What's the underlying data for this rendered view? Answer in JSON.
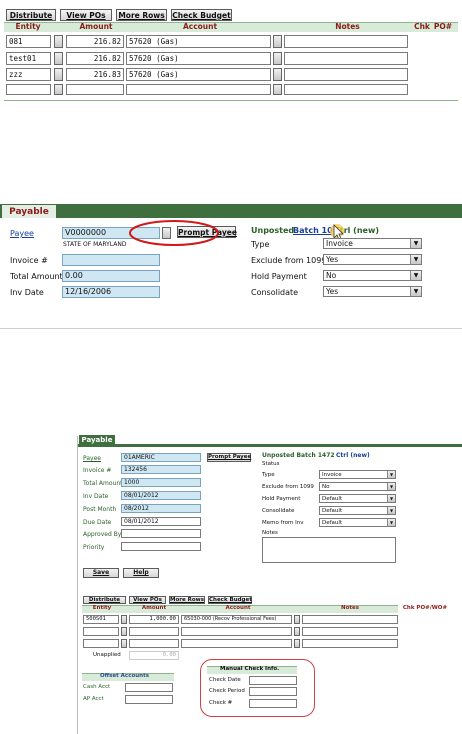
{
  "s1": {
    "buttons": {
      "distribute": "Distribute",
      "view_pos": "View POs",
      "more_rows": "More Rows",
      "check_budget": "Check Budget"
    },
    "headers": {
      "entity": "Entity",
      "amount": "Amount",
      "account": "Account",
      "notes": "Notes",
      "chk": "Chk",
      "po": "PO#"
    },
    "rows": [
      {
        "entity": "081",
        "amount": "216.82",
        "account": "57620 (Gas)"
      },
      {
        "entity": "test01",
        "amount": "216.82",
        "account": "57620 (Gas)"
      },
      {
        "entity": "zzz",
        "amount": "216.83",
        "account": "57620 (Gas)"
      },
      {
        "entity": "",
        "amount": "",
        "account": ""
      }
    ]
  },
  "s2": {
    "tab": "Payable",
    "payee_label": "Payee",
    "payee_value": "V0000000",
    "payee_name": "STATE OF MARYLAND",
    "prompt_payee": "Prompt Payee",
    "invoice_label": "Invoice #",
    "invoice_value": "",
    "total_label": "Total Amount",
    "total_value": "0.00",
    "invdate_label": "Inv Date",
    "invdate_value": "12/16/2006",
    "unposted": "Unposted",
    "batch_prefix": "Batch 10",
    "batch_suffix": "Ctrl (new)",
    "type_label": "Type",
    "type_value": "Invoice",
    "exclude_label": "Exclude from 1099",
    "exclude_value": "Yes",
    "hold_label": "Hold Payment",
    "hold_value": "No",
    "consol_label": "Consolidate",
    "consol_value": "Yes"
  },
  "s3": {
    "tab": "Payable",
    "left": [
      {
        "label": "Payee",
        "value": "01AMERIC",
        "link": true
      },
      {
        "label": "Invoice #",
        "value": "132456"
      },
      {
        "label": "Total Amount",
        "value": "1000"
      },
      {
        "label": "Inv Date",
        "value": "08/01/2012"
      },
      {
        "label": "Post Month",
        "value": "08/2012"
      },
      {
        "label": "Due Date",
        "value": "08/01/2012"
      },
      {
        "label": "Approved By",
        "value": ""
      },
      {
        "label": "Priority",
        "value": ""
      }
    ],
    "prompt_payee": "Prompt Payee",
    "unposted": "Unposted Batch 1472",
    "ctrl": "Ctrl (new)",
    "status_label": "Status",
    "right": [
      {
        "label": "Type",
        "value": "Invoice"
      },
      {
        "label": "Exclude from 1099",
        "value": "No"
      },
      {
        "label": "Hold Payment",
        "value": "Default"
      },
      {
        "label": "Consolidate",
        "value": "Default"
      },
      {
        "label": "Memo from Inv",
        "value": "Default"
      }
    ],
    "notes_label": "Notes",
    "save": "Save",
    "help": "Help",
    "buttons": {
      "distribute": "Distribute",
      "view_pos": "View POs",
      "more_rows": "More Rows",
      "check_budget": "Check Budget"
    },
    "headers": {
      "entity": "Entity",
      "amount": "Amount",
      "account": "Account",
      "notes": "Notes",
      "chk": "Chk PO#/WO#"
    },
    "rows": [
      {
        "entity": "500S01",
        "amount": "1,000.00",
        "account": "65030-000 (Recov  Professional Fees)"
      },
      {
        "entity": "",
        "amount": "",
        "account": ""
      },
      {
        "entity": "",
        "amount": "",
        "account": ""
      }
    ],
    "unapplied_label": "Unapplied",
    "unapplied_value": "0.00",
    "offset_title": "Offset Accounts",
    "cash_acct": "Cash Acct",
    "ap_acct": "AP Acct",
    "manual_title": "Manual Check Info.",
    "check_date": "Check Date",
    "check_period": "Check Period",
    "check_no": "Check #"
  }
}
